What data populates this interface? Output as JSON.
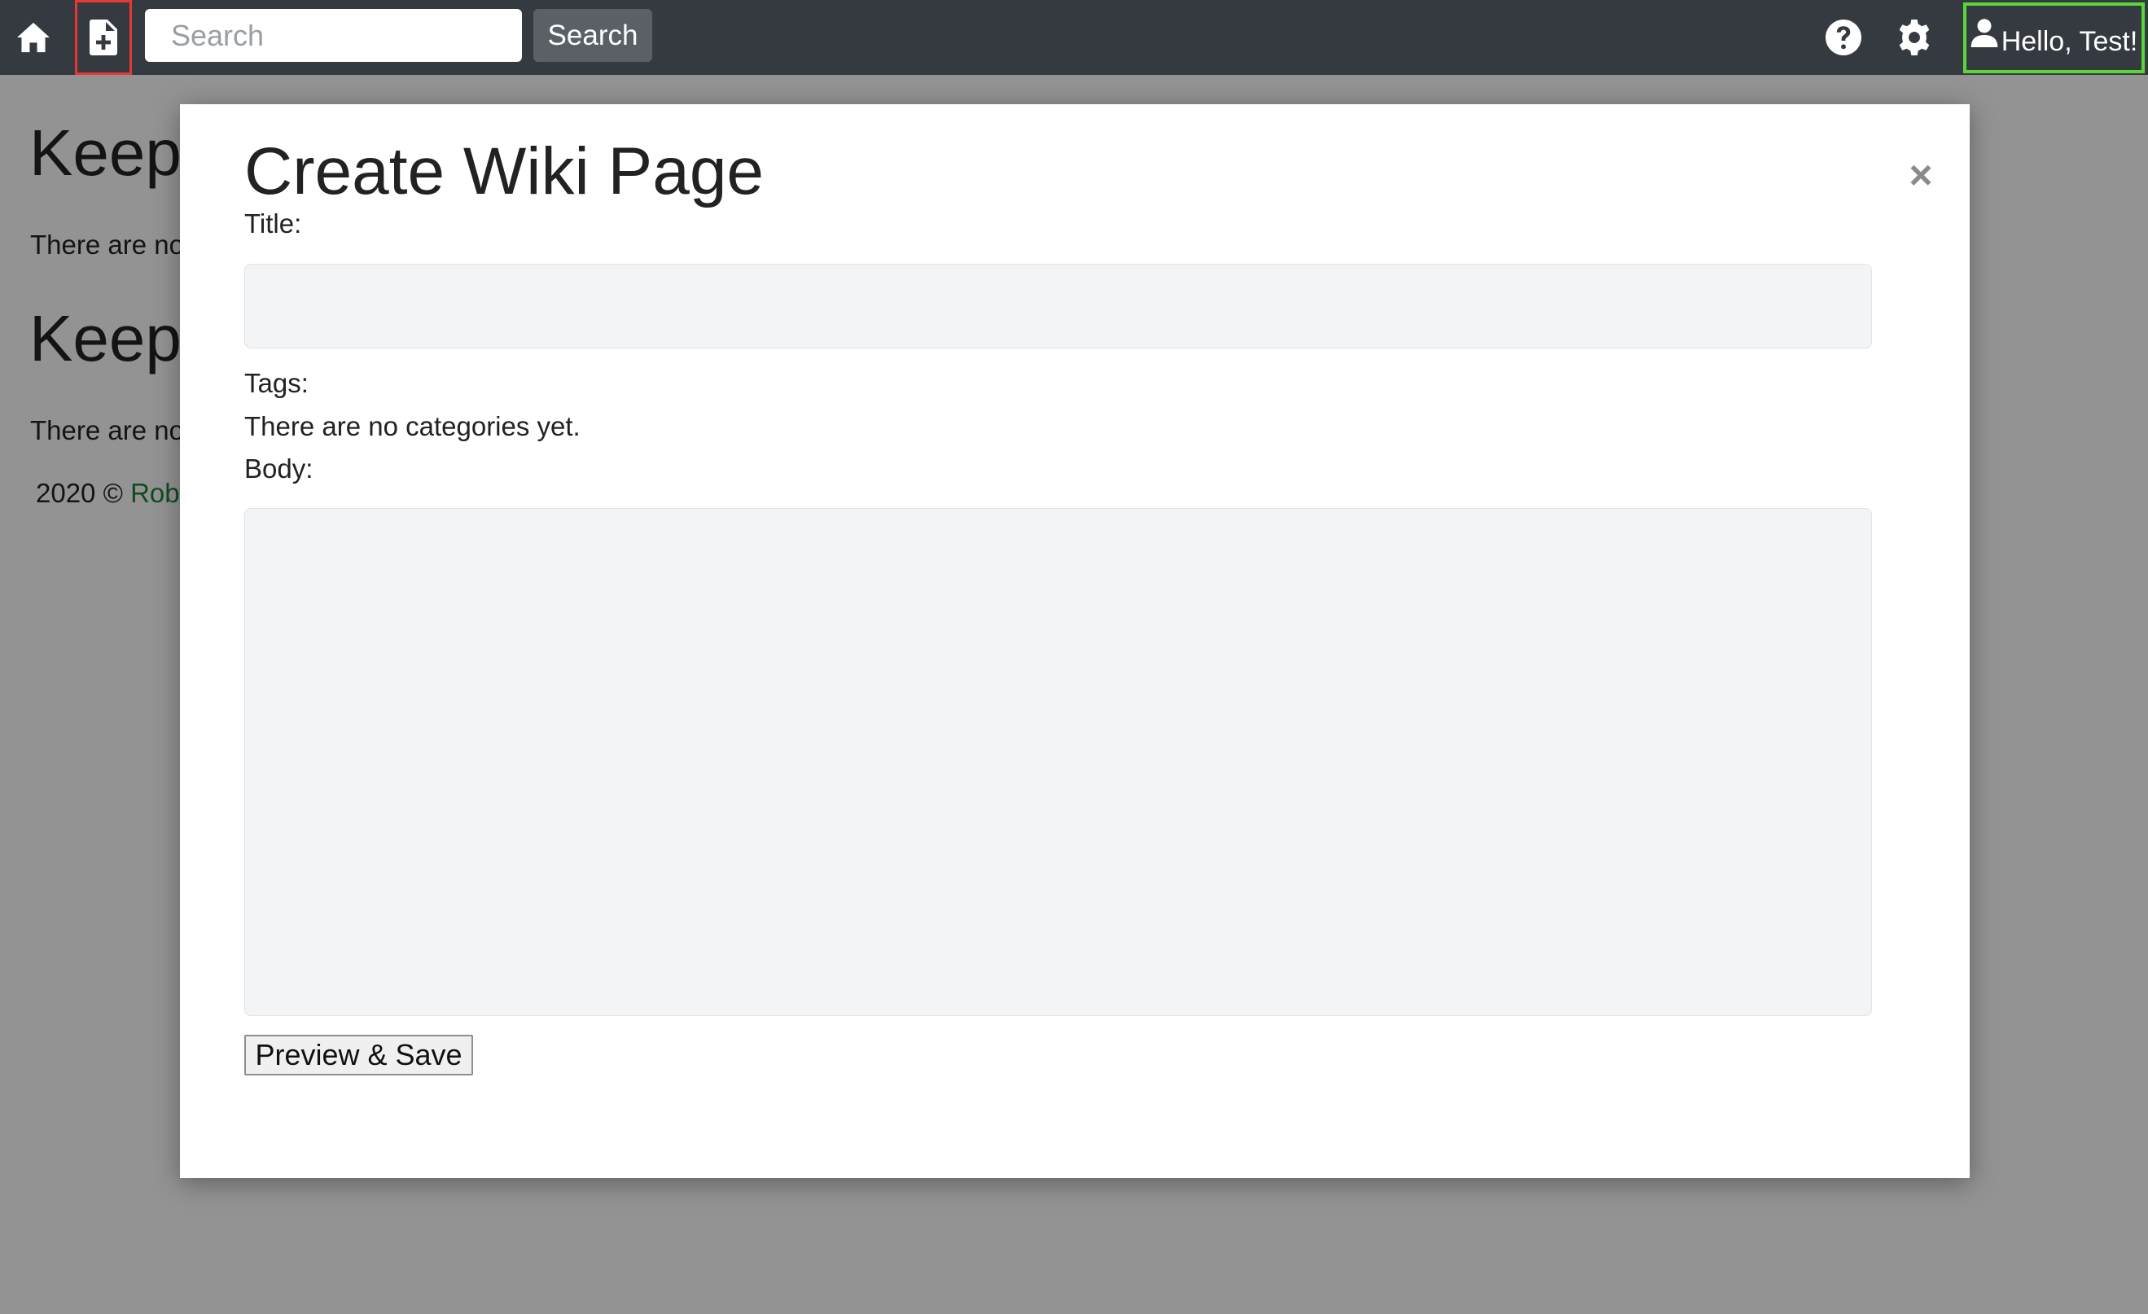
{
  "navbar": {
    "home_icon": "home-icon",
    "new_page_icon": "file-plus-icon",
    "search": {
      "placeholder": "Search",
      "value": "",
      "button_label": "Search"
    },
    "help_icon": "question-circle-icon",
    "settings_icon": "gear-icon",
    "user": {
      "icon": "user-icon",
      "label": "Hello, Test!"
    }
  },
  "background_page": {
    "heading_1": "Keep",
    "text_1": "There are no",
    "heading_2": "Keep",
    "text_2": "There are no",
    "footer": {
      "prefix": "2020 ©",
      "link": "Rob"
    }
  },
  "modal": {
    "title": "Create Wiki Page",
    "close_label": "×",
    "title_label": "Title:",
    "title_value": "",
    "tags_label": "Tags:",
    "tags_empty_text": "There are no categories yet.",
    "body_label": "Body:",
    "body_value": "",
    "submit_label": "Preview & Save"
  },
  "colors": {
    "navbar_bg": "#343a40",
    "new_page_highlight": "#e53935",
    "user_highlight": "#5bd63a",
    "footer_link": "#1e7e34",
    "input_bg": "#f3f4f5"
  }
}
